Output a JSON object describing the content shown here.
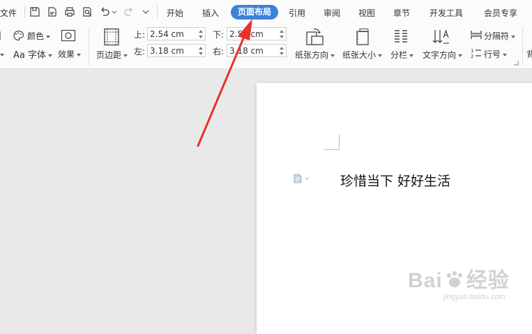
{
  "menubar": {
    "file_label": "文件",
    "tabs": [
      {
        "label": "开始"
      },
      {
        "label": "插入"
      },
      {
        "label": "页面布局"
      },
      {
        "label": "引用"
      },
      {
        "label": "审阅"
      },
      {
        "label": "视图"
      },
      {
        "label": "章节"
      },
      {
        "label": "开发工具"
      },
      {
        "label": "会员专享"
      }
    ],
    "active_tab": "页面布局"
  },
  "ribbon": {
    "theme_color_label": "颜色",
    "theme_font_label": "字体",
    "theme_font_prefix": "Aa",
    "theme_effect_label": "效果",
    "margins_label": "页边距",
    "margin_top_label": "上:",
    "margin_top_value": "2.54 cm",
    "margin_bottom_label": "下:",
    "margin_bottom_value": "2.54 cm",
    "margin_left_label": "左:",
    "margin_left_value": "3.18 cm",
    "margin_right_label": "右:",
    "margin_right_value": "3.18 cm",
    "orientation_label": "纸张方向",
    "paper_size_label": "纸张大小",
    "columns_label": "分栏",
    "text_direction_label": "文字方向",
    "separator_label": "分隔符",
    "line_number_label": "行号",
    "cut_off_label": "背"
  },
  "document": {
    "text": "珍惜当下  好好生活"
  },
  "watermark": {
    "brand": "Bai",
    "brand_cn": "经验",
    "url": "jingyan.baidu.com"
  },
  "colors": {
    "accent": "#3c82d8",
    "arrow": "#e8312a"
  }
}
